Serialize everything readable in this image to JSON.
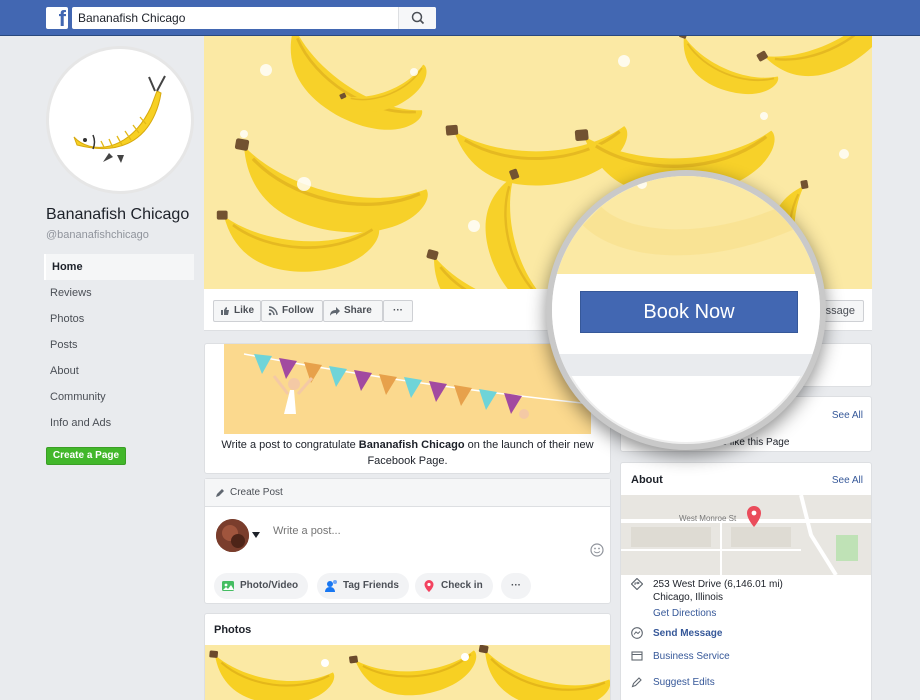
{
  "header": {
    "logo": "f",
    "search_value": "Bananafish Chicago"
  },
  "profile": {
    "name": "Bananafish Chicago",
    "handle": "@bananafishchicago"
  },
  "nav": {
    "items": [
      {
        "label": "Home",
        "active": true
      },
      {
        "label": "Reviews"
      },
      {
        "label": "Photos"
      },
      {
        "label": "Posts"
      },
      {
        "label": "About"
      },
      {
        "label": "Community"
      },
      {
        "label": "Info and Ads"
      }
    ],
    "create_page": "Create a Page"
  },
  "actions": {
    "like": "Like",
    "follow": "Follow",
    "share": "Share",
    "more": "···",
    "message_partial": "ssage"
  },
  "magnifier": {
    "book_now": "Book Now"
  },
  "congrats": {
    "pre": "Write a post to congratulate ",
    "name": "Bananafish Chicago",
    "post": " on the launch of their new Facebook Page."
  },
  "create_post": {
    "header": "Create Post",
    "placeholder": "Write a post...",
    "chips": [
      "Photo/Video",
      "Tag Friends",
      "Check in",
      "···"
    ]
  },
  "photos": {
    "title": "Photos"
  },
  "right": {
    "see_all": "See All",
    "like_partial": "s to like this Page",
    "about_title": "About",
    "map_street": "West Monroe St",
    "address_line1": "253 West Drive (6,146.01 mi)",
    "address_line2": "Chicago, Illinois",
    "get_directions": "Get Directions",
    "send_message": "Send Message",
    "business_service": "Business Service",
    "suggest_edits": "Suggest Edits"
  },
  "colors": {
    "fb_blue": "#4267b2",
    "link_blue": "#365899",
    "green": "#42b72a",
    "banana_yellow": "#f7d023",
    "cover_bg": "#fbe9a4"
  }
}
